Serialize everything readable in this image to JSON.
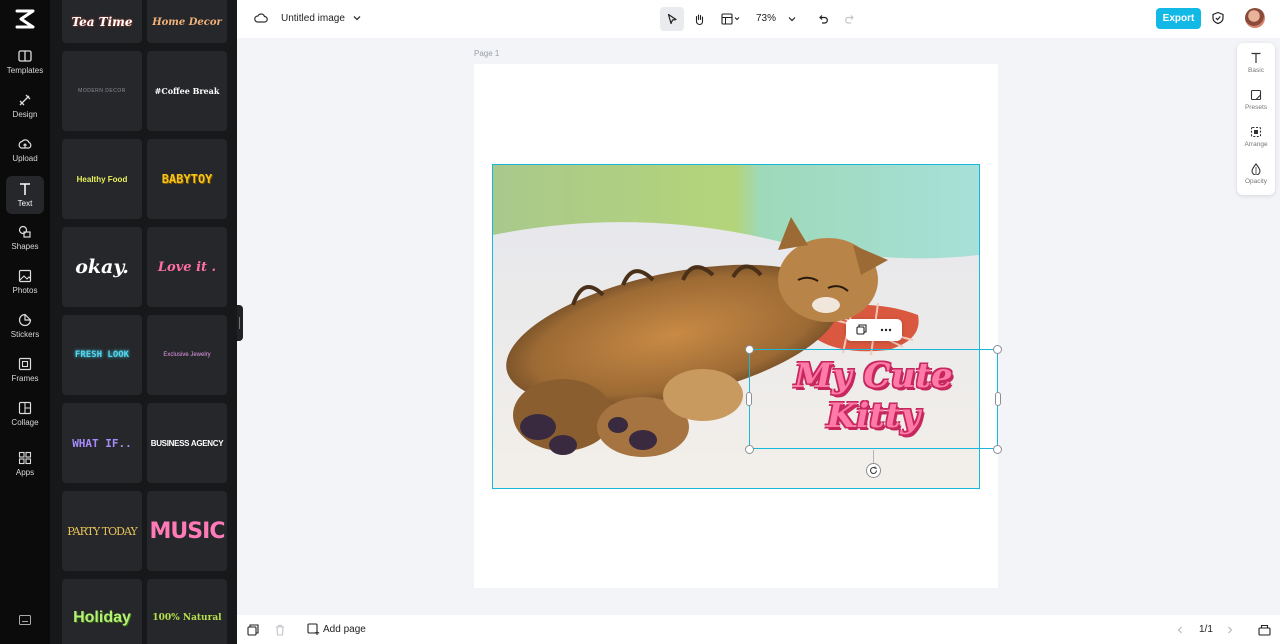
{
  "left_nav": {
    "items": [
      {
        "label": "Templates",
        "icon": "templates-icon"
      },
      {
        "label": "Design",
        "icon": "design-icon"
      },
      {
        "label": "Upload",
        "icon": "upload-icon"
      },
      {
        "label": "Text",
        "icon": "text-icon",
        "active": true
      },
      {
        "label": "Shapes",
        "icon": "shapes-icon"
      },
      {
        "label": "Photos",
        "icon": "photos-icon"
      },
      {
        "label": "Stickers",
        "icon": "stickers-icon"
      },
      {
        "label": "Frames",
        "icon": "frames-icon"
      },
      {
        "label": "Collage",
        "icon": "collage-icon"
      },
      {
        "label": "Apps",
        "icon": "apps-icon"
      }
    ]
  },
  "text_panel": {
    "templates": [
      {
        "text": "Tea Time",
        "color": "#ffffff"
      },
      {
        "text": "Home Decor",
        "color": "#f2b27a"
      },
      {
        "text": "MODERN DECOR",
        "color": "#8b8f96"
      },
      {
        "text": "#Coffee Break",
        "color": "#ffffff"
      },
      {
        "text": "Healthy Food",
        "color": "#e8f05a"
      },
      {
        "text": "BABYTOY",
        "color": "#f5c518"
      },
      {
        "text": "okay.",
        "color": "#ffffff"
      },
      {
        "text": "Love it .",
        "color": "#ff6fa3"
      },
      {
        "text": "FRESH LOOK",
        "color": "#4fd8f0"
      },
      {
        "text": "Exclusive Jewelry",
        "color": "#e79be8"
      },
      {
        "text": "WHAT IF..",
        "color": "#a78bfa"
      },
      {
        "text": "BUSINESS AGENCY",
        "color": "#ffffff"
      },
      {
        "text": "PARTY TODAY",
        "color": "#e7c25a"
      },
      {
        "text": "MUSIC",
        "color": "#ff7ab6"
      },
      {
        "text": "Holiday",
        "color": "#b6f07a"
      },
      {
        "text": "100% Natural",
        "color": "#b7e04a"
      }
    ]
  },
  "topbar": {
    "title": "Untitled image",
    "zoom": "73%",
    "export_label": "Export"
  },
  "canvas": {
    "page_label": "Page 1",
    "text_element": "My Cute Kitty"
  },
  "right_panel": {
    "items": [
      {
        "label": "Basic",
        "icon": "text-basic-icon"
      },
      {
        "label": "Presets",
        "icon": "presets-icon"
      },
      {
        "label": "Arrange",
        "icon": "arrange-icon"
      },
      {
        "label": "Opacity",
        "icon": "opacity-icon"
      }
    ]
  },
  "bottombar": {
    "add_page_label": "Add page",
    "page_count": "1/1"
  },
  "colors": {
    "accent": "#12b9e6",
    "selection": "#19b7d9",
    "text_fill": "#ff7aa8",
    "text_stroke": "#c6285e"
  }
}
